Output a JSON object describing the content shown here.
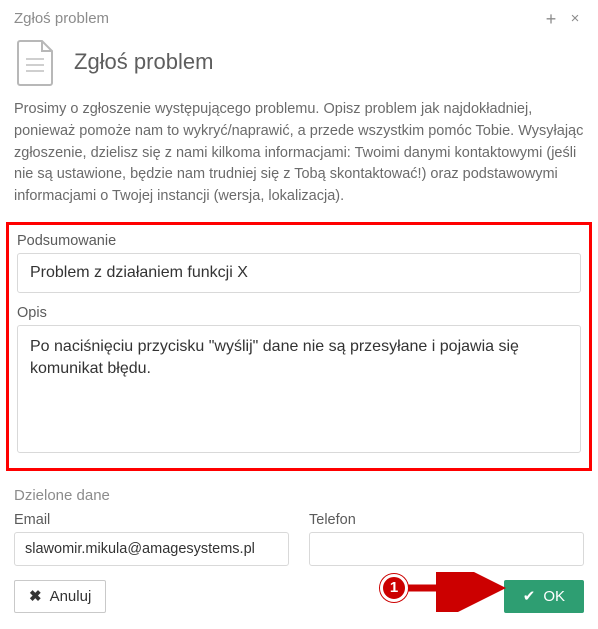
{
  "dialog": {
    "title": "Zgłoś problem",
    "header": "Zgłoś problem",
    "intro": "Prosimy o zgłoszenie występującego problemu. Opisz problem jak najdokładniej, ponieważ pomoże nam to wykryć/naprawić, a przede wszystkim pomóc Tobie. Wysyłając zgłoszenie, dzielisz się z nami kilkoma informacjami: Twoimi danymi kontaktowymi (jeśli nie są ustawione, będzie nam trudniej się z Tobą skontaktować!) oraz podstawowymi informacjami o Twojej instancji (wersja, lokalizacja)."
  },
  "form": {
    "summary_label": "Podsumowanie",
    "summary_value": "Problem z działaniem funkcji X",
    "description_label": "Opis",
    "description_value": "Po naciśnięciu przycisku \"wyślij\" dane nie są przesyłane i pojawia się komunikat błędu."
  },
  "shared": {
    "section_title": "Dzielone dane",
    "email_label": "Email",
    "email_value": "slawomir.mikula@amagesystems.pl",
    "phone_label": "Telefon",
    "phone_value": ""
  },
  "actions": {
    "cancel": "Anuluj",
    "ok": "OK"
  },
  "annotation": {
    "marker": "1"
  }
}
